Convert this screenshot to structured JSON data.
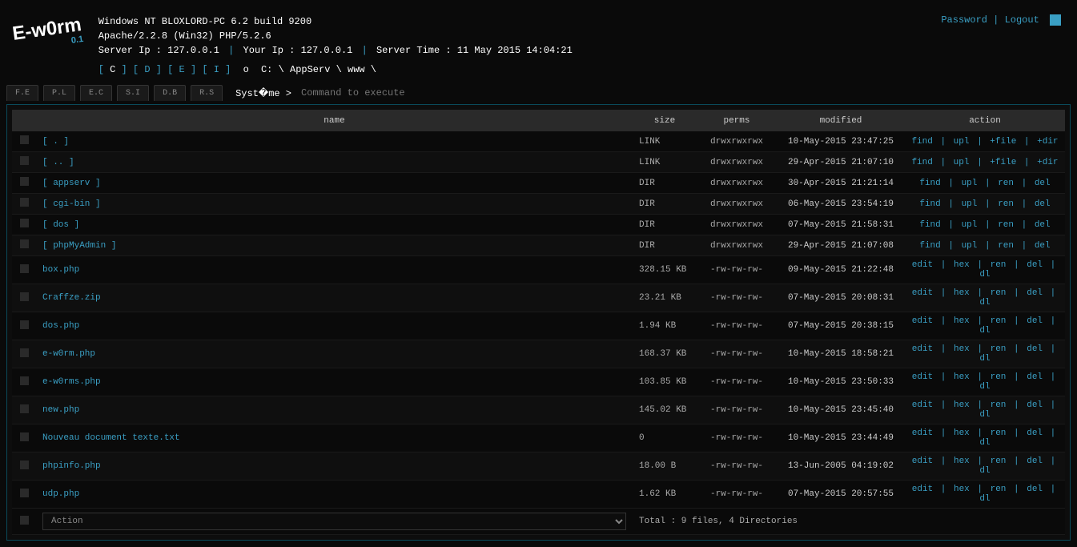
{
  "logo": {
    "name": "E-w0rm",
    "version": "0.1"
  },
  "toplinks": {
    "password": "Password",
    "logout": "Logout"
  },
  "sysinfo": {
    "line1": "Windows NT BLOXLORD-PC 6.2 build 9200",
    "line2": "Apache/2.2.8 (Win32) PHP/5.2.6",
    "server_ip_label": "Server Ip : ",
    "server_ip": "127.0.0.1",
    "your_ip_label": "Your Ip : ",
    "your_ip": "127.0.0.1",
    "server_time_label": "Server Time : ",
    "server_time": "11 May 2015 14:04:21"
  },
  "drives": {
    "items": [
      "C",
      "D",
      "E",
      "I"
    ],
    "active": "C",
    "o": "o",
    "path": "C: \\ AppServ \\ www \\"
  },
  "tabs": [
    "F.E",
    "P.L",
    "E.C",
    "S.I",
    "D.B",
    "R.S"
  ],
  "cmd": {
    "label": "Syst�me >",
    "placeholder": "Command to execute"
  },
  "columns": {
    "name": "name",
    "size": "size",
    "perms": "perms",
    "modified": "modified",
    "action": "action"
  },
  "rows": [
    {
      "name": "[ . ]",
      "size": "LINK",
      "perms": "drwxrwxrwx",
      "modified": "10-May-2015 23:47:25",
      "actions": [
        "find",
        "upl",
        "+file",
        "+dir"
      ]
    },
    {
      "name": "[ .. ]",
      "size": "LINK",
      "perms": "drwxrwxrwx",
      "modified": "29-Apr-2015 21:07:10",
      "actions": [
        "find",
        "upl",
        "+file",
        "+dir"
      ]
    },
    {
      "name": "[ appserv ]",
      "size": "DIR",
      "perms": "drwxrwxrwx",
      "modified": "30-Apr-2015 21:21:14",
      "actions": [
        "find",
        "upl",
        "ren",
        "del"
      ]
    },
    {
      "name": "[ cgi-bin ]",
      "size": "DIR",
      "perms": "drwxrwxrwx",
      "modified": "06-May-2015 23:54:19",
      "actions": [
        "find",
        "upl",
        "ren",
        "del"
      ]
    },
    {
      "name": "[ dos ]",
      "size": "DIR",
      "perms": "drwxrwxrwx",
      "modified": "07-May-2015 21:58:31",
      "actions": [
        "find",
        "upl",
        "ren",
        "del"
      ]
    },
    {
      "name": "[ phpMyAdmin ]",
      "size": "DIR",
      "perms": "drwxrwxrwx",
      "modified": "29-Apr-2015 21:07:08",
      "actions": [
        "find",
        "upl",
        "ren",
        "del"
      ]
    },
    {
      "name": "box.php",
      "size": "328.15 KB",
      "perms": "-rw-rw-rw-",
      "modified": "09-May-2015 21:22:48",
      "actions": [
        "edit",
        "hex",
        "ren",
        "del",
        "dl"
      ]
    },
    {
      "name": "Craffze.zip",
      "size": "23.21 KB",
      "perms": "-rw-rw-rw-",
      "modified": "07-May-2015 20:08:31",
      "actions": [
        "edit",
        "hex",
        "ren",
        "del",
        "dl"
      ]
    },
    {
      "name": "dos.php",
      "size": "1.94 KB",
      "perms": "-rw-rw-rw-",
      "modified": "07-May-2015 20:38:15",
      "actions": [
        "edit",
        "hex",
        "ren",
        "del",
        "dl"
      ]
    },
    {
      "name": "e-w0rm.php",
      "size": "168.37 KB",
      "perms": "-rw-rw-rw-",
      "modified": "10-May-2015 18:58:21",
      "actions": [
        "edit",
        "hex",
        "ren",
        "del",
        "dl"
      ]
    },
    {
      "name": "e-w0rms.php",
      "size": "103.85 KB",
      "perms": "-rw-rw-rw-",
      "modified": "10-May-2015 23:50:33",
      "actions": [
        "edit",
        "hex",
        "ren",
        "del",
        "dl"
      ]
    },
    {
      "name": "new.php",
      "size": "145.02 KB",
      "perms": "-rw-rw-rw-",
      "modified": "10-May-2015 23:45:40",
      "actions": [
        "edit",
        "hex",
        "ren",
        "del",
        "dl"
      ]
    },
    {
      "name": "Nouveau document texte.txt",
      "size": "0",
      "perms": "-rw-rw-rw-",
      "modified": "10-May-2015 23:44:49",
      "actions": [
        "edit",
        "hex",
        "ren",
        "del",
        "dl"
      ]
    },
    {
      "name": "phpinfo.php",
      "size": "18.00 B",
      "perms": "-rw-rw-rw-",
      "modified": "13-Jun-2005 04:19:02",
      "actions": [
        "edit",
        "hex",
        "ren",
        "del",
        "dl"
      ]
    },
    {
      "name": "udp.php",
      "size": "1.62 KB",
      "perms": "-rw-rw-rw-",
      "modified": "07-May-2015 20:57:55",
      "actions": [
        "edit",
        "hex",
        "ren",
        "del",
        "dl"
      ]
    }
  ],
  "footer": {
    "action_placeholder": "Action",
    "total": "Total : 9 files, 4 Directories"
  }
}
